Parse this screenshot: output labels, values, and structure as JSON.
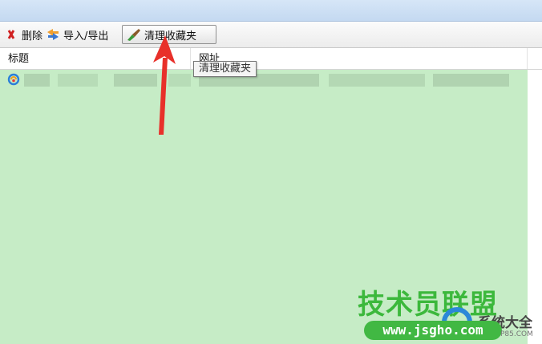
{
  "toolbar": {
    "delete_label": "删除",
    "import_export_label": "导入/导出",
    "clean_label": "清理收藏夹"
  },
  "columns": {
    "title": "标题",
    "url": "网址"
  },
  "tooltip": {
    "text": "清理收藏夹"
  },
  "watermark": {
    "main": "技术员联盟",
    "url": "www.jsgho.com",
    "extra": "系统大全",
    "small": "P85.COM"
  },
  "colors": {
    "overlay": "#c6ecc6",
    "arrow": "#e8302a",
    "watermark_green": "#3cb83c"
  },
  "icons": [
    "delete-icon",
    "import-export-icon",
    "broom-icon",
    "favicon-icon"
  ]
}
